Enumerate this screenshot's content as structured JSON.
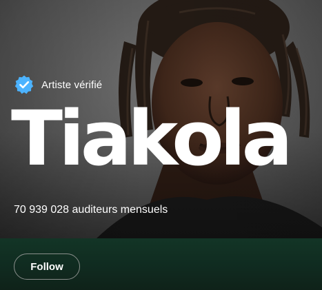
{
  "artist": {
    "verified_label": "Artiste vérifié",
    "name": "Tiakola",
    "monthly_listeners": "70 939 028 auditeurs mensuels"
  },
  "actions": {
    "follow_label": "Follow"
  },
  "icons": {
    "verified": "verified-badge-icon"
  },
  "colors": {
    "verified_badge": "#4cb3ff",
    "action_bar": "#133526",
    "text": "#ffffff"
  }
}
